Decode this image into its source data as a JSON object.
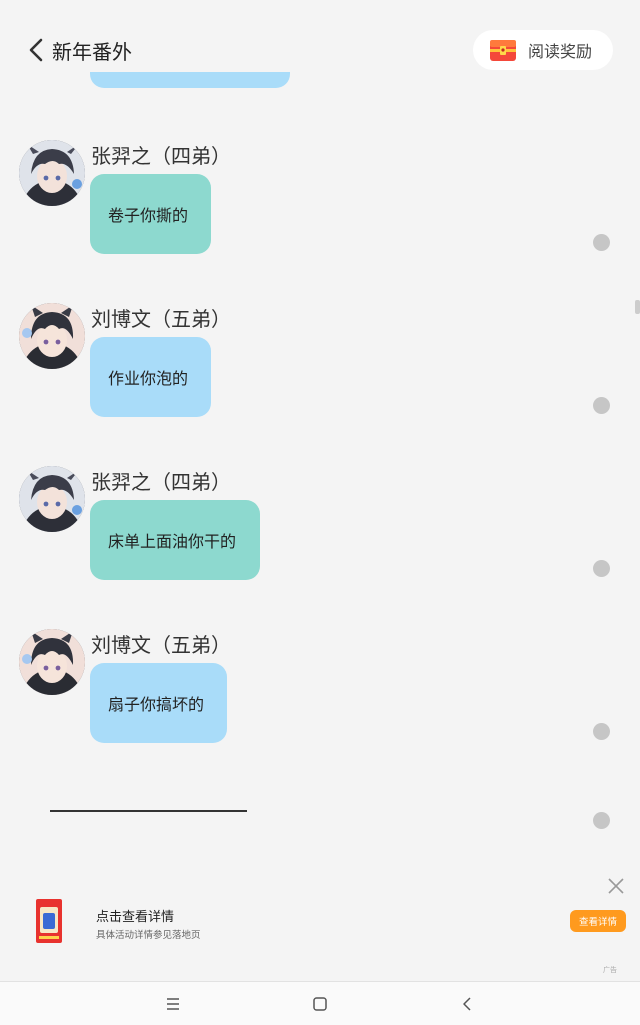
{
  "header": {
    "title": "新年番外",
    "reward_label": "阅读奖励"
  },
  "messages": [
    {
      "sender": "张羿之（四弟）",
      "text": "卷子你撕的",
      "color": "#8dd9cf"
    },
    {
      "sender": "刘博文（五弟）",
      "text": "作业你泡的",
      "color": "#a9dcf9"
    },
    {
      "sender": "张羿之（四弟）",
      "text": "床单上面油你干的",
      "color": "#8dd9cf"
    },
    {
      "sender": "刘博文（五弟）",
      "text": "扇子你搞坏的",
      "color": "#a9dcf9"
    }
  ],
  "ad": {
    "title": "点击查看详情",
    "subtitle": "具体活动详情参见落地页",
    "button": "查看详情",
    "tag": "广告"
  },
  "navbar": {
    "icons": [
      "menu-icon",
      "home-icon",
      "back-icon"
    ]
  }
}
